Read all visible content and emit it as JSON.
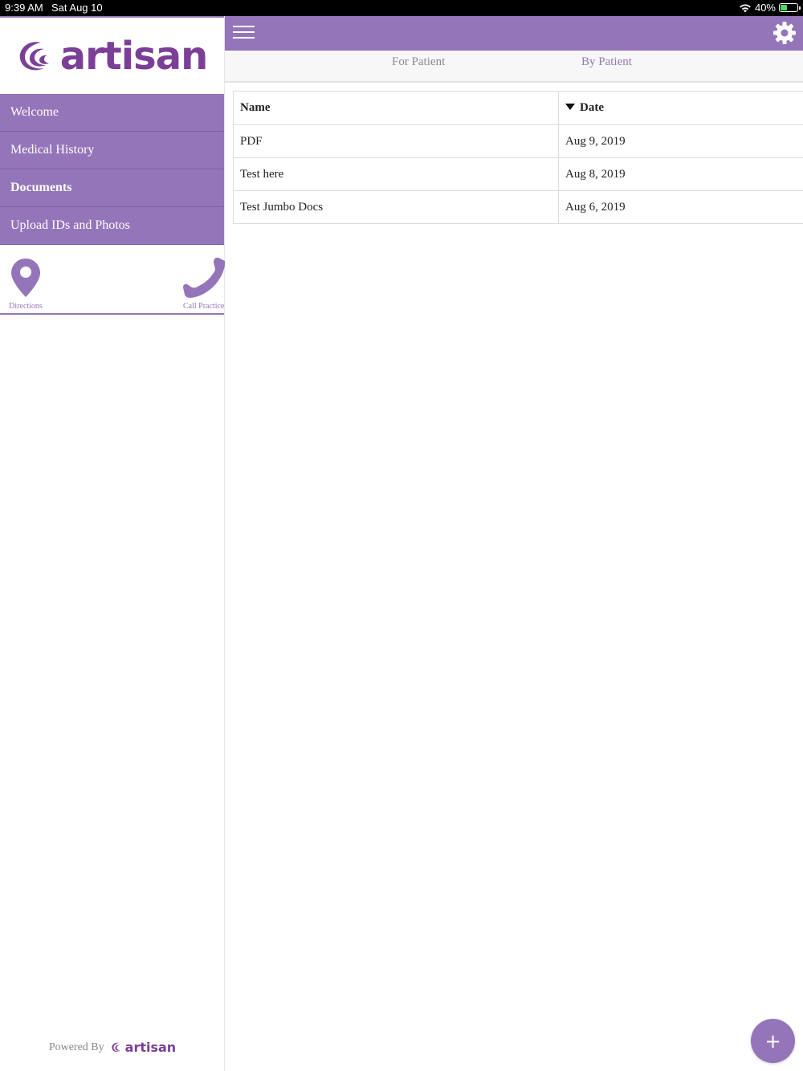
{
  "status_bar": {
    "time": "9:39 AM",
    "date": "Sat Aug 10",
    "battery": "40%",
    "battery_level": 0.4
  },
  "sidebar": {
    "brand": "artisan",
    "items": [
      {
        "label": "Welcome",
        "active": false
      },
      {
        "label": "Medical History",
        "active": false
      },
      {
        "label": "Documents",
        "active": true
      },
      {
        "label": "Upload IDs and Photos",
        "active": false
      }
    ],
    "quick_actions": {
      "directions": "Directions",
      "call": "Call Practice"
    },
    "powered_by": "Powered By",
    "footer_brand": "artisan"
  },
  "tabs": {
    "for_patient": "For Patient",
    "by_patient": "By Patient"
  },
  "table": {
    "headers": {
      "name": "Name",
      "date": "Date"
    },
    "rows": [
      {
        "name": "PDF",
        "date": "Aug 9, 2019"
      },
      {
        "name": "Test here",
        "date": "Aug 8, 2019"
      },
      {
        "name": "Test Jumbo Docs",
        "date": "Aug 6, 2019"
      }
    ]
  },
  "fab": {
    "label": "+"
  },
  "colors": {
    "accent": "#9575b9",
    "brand": "#7b3f98",
    "status_bar": "#000000"
  },
  "icons": [
    "wifi-icon",
    "battery-icon",
    "hamburger-icon",
    "gear-icon",
    "location-pin-icon",
    "phone-icon",
    "sort-desc-icon",
    "plus-icon"
  ]
}
